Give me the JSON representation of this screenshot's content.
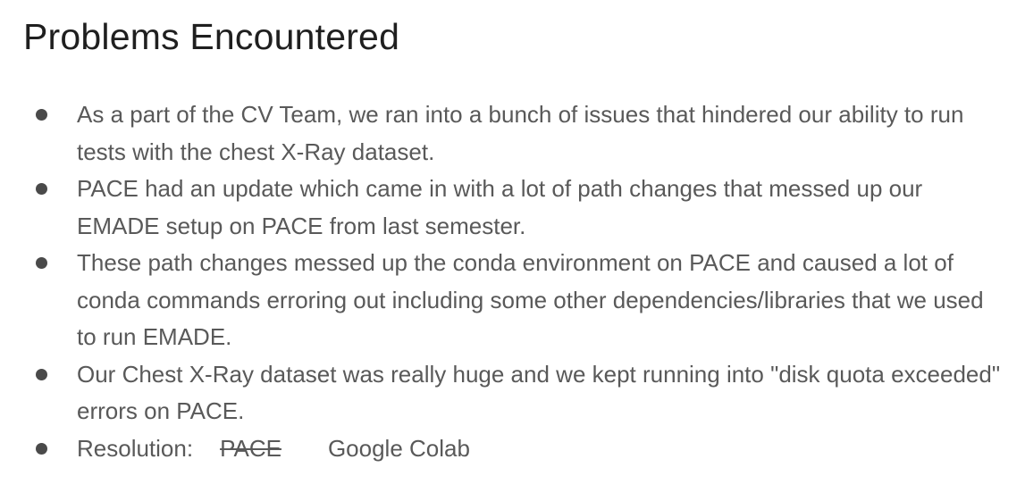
{
  "slide": {
    "title": "Problems Encountered",
    "bullets": [
      "As a part of the CV Team, we ran into a bunch of issues that hindered our ability to run tests with the chest X-Ray dataset.",
      "PACE had an update which came in with a lot of path changes that messed up our EMADE setup on PACE from last semester.",
      "These path changes messed up the conda environment on PACE and caused a lot of conda commands erroring out including some other dependencies/libraries that we used to run EMADE.",
      "Our Chest X-Ray dataset was really huge and we kept running into \"disk quota exceeded\" errors on PACE."
    ],
    "resolution": {
      "label": "Resolution:",
      "old": "PACE",
      "new": "Google Colab"
    }
  },
  "colors": {
    "title": "#1f1f1f",
    "body_text": "#595959",
    "bullet": "#4a4a4a",
    "background": "#ffffff"
  }
}
